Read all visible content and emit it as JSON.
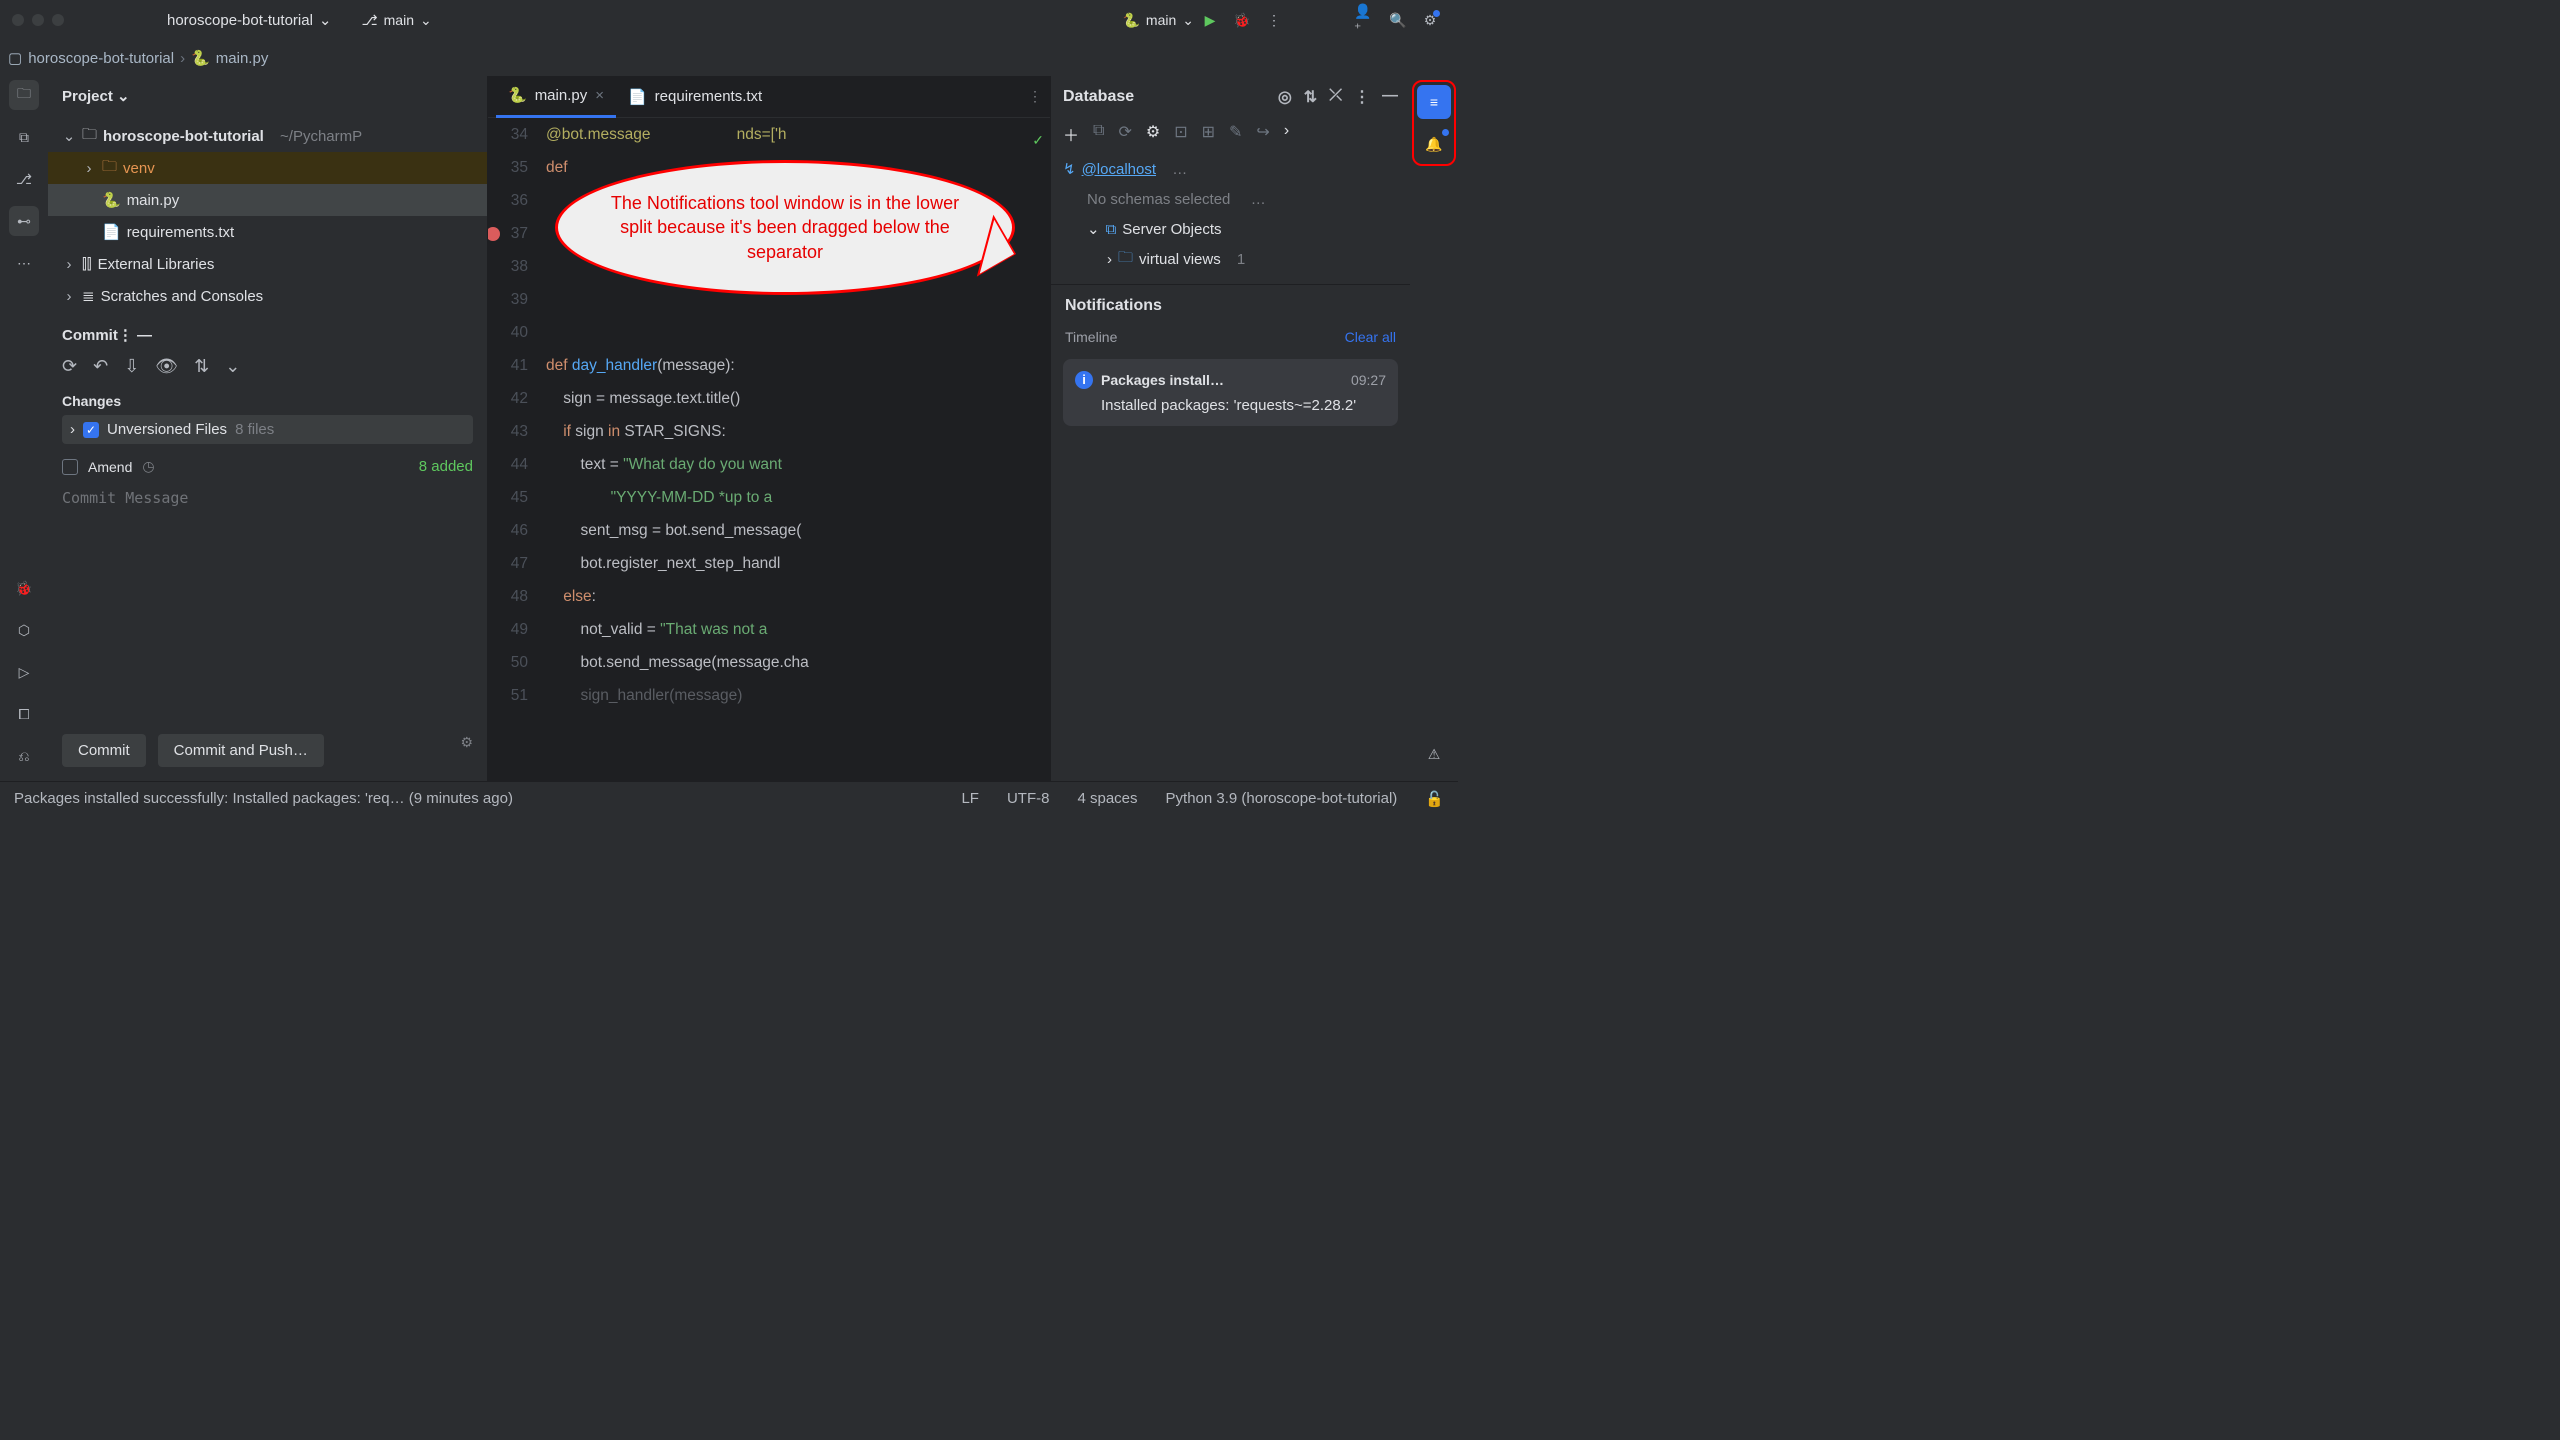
{
  "titlebar": {
    "project": "horoscope-bot-tutorial",
    "branch": "main",
    "run_config": "main"
  },
  "breadcrumb": {
    "root": "horoscope-bot-tutorial",
    "file": "main.py"
  },
  "project_panel": {
    "title": "Project",
    "root": "horoscope-bot-tutorial",
    "root_path": "~/PycharmP",
    "items": [
      "venv",
      "main.py",
      "requirements.txt"
    ],
    "extlib": "External Libraries",
    "scratches": "Scratches and Consoles"
  },
  "commit": {
    "title": "Commit",
    "changes": "Changes",
    "unversioned": "Unversioned Files",
    "unversioned_count": "8 files",
    "amend": "Amend",
    "added": "8 added",
    "placeholder": "Commit Message",
    "btn_commit": "Commit",
    "btn_push": "Commit and Push…"
  },
  "editor": {
    "tabs": [
      "main.py",
      "requirements.txt"
    ],
    "gutter_start": 34,
    "line34": "@bot.message",
    "line34b": "nds=['h",
    "line35": "def",
    "line41a": "def ",
    "line41b": "day_handler",
    "line41c": "(message):",
    "line42": "    sign = message.text.title()",
    "line43a": "    ",
    "line43kw": "if",
    "line43b": " sign ",
    "line43kw2": "in",
    "line43c": " STAR_SIGNS:",
    "line44a": "        text = ",
    "line44s": "\"What day do you want",
    "line45s": "               \"YYYY-MM-DD *up to a ",
    "line46": "        sent_msg = bot.send_message(",
    "line47": "        bot.register_next_step_handl",
    "line48a": "    ",
    "line48kw": "else",
    "line48b": ":",
    "line49a": "        not_valid = ",
    "line49s": "\"That was not a ",
    "line50": "        bot.send_message(message.cha",
    "line51": "        sign_handler(message)"
  },
  "database": {
    "title": "Database",
    "host": "@localhost",
    "ell": "…",
    "no_schemas": "No schemas selected",
    "no_schemas_ell": "…",
    "server_objects": "Server Objects",
    "virtual_views": "virtual views",
    "vv_count": "1"
  },
  "notifications": {
    "title": "Notifications",
    "timeline": "Timeline",
    "clear": "Clear all",
    "card_title": "Packages install…",
    "card_time": "09:27",
    "card_body": "Installed packages: 'requests~=2.28.2'"
  },
  "callout": "The Notifications tool window is in the lower split because it's been dragged below the separator",
  "status": {
    "msg": "Packages installed successfully: Installed packages: 'req… (9 minutes ago)",
    "lf": "LF",
    "enc": "UTF-8",
    "indent": "4 spaces",
    "interp": "Python 3.9 (horoscope-bot-tutorial)"
  }
}
